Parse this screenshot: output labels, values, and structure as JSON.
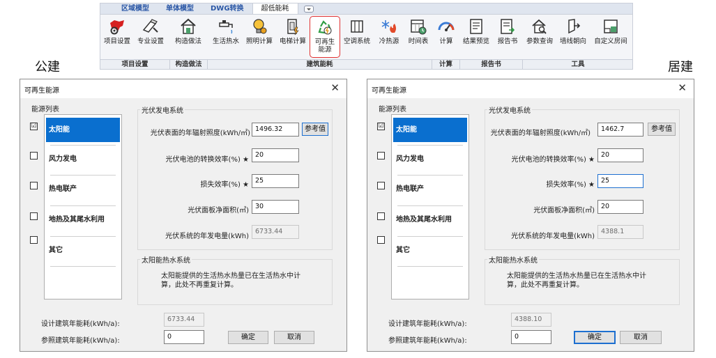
{
  "ribbon": {
    "tabs": [
      "区域模型",
      "单体模型",
      "DWG转换",
      "超低能耗"
    ],
    "buttons": [
      {
        "label": "项目设置",
        "icon": "project-settings-icon"
      },
      {
        "label": "专业设置",
        "icon": "professional-settings-icon"
      },
      {
        "label": "构造做法",
        "icon": "construction-icon"
      },
      {
        "label": "生活热水",
        "icon": "hot-water-faucet-icon"
      },
      {
        "label": "照明计算",
        "icon": "lightbulb-icon"
      },
      {
        "label": "电梯计算",
        "icon": "elevator-icon"
      },
      {
        "label": "可再生\n能源",
        "icon": "renewable-energy-icon"
      },
      {
        "label": "空调系统",
        "icon": "air-conditioner-icon"
      },
      {
        "label": "冷热源",
        "icon": "cold-heat-source-icon"
      },
      {
        "label": "时间表",
        "icon": "schedule-icon"
      },
      {
        "label": "计算",
        "icon": "gauge-icon"
      },
      {
        "label": "结果预览",
        "icon": "result-preview-icon"
      },
      {
        "label": "报告书",
        "icon": "report-icon"
      },
      {
        "label": "参数查询",
        "icon": "parameter-query-icon"
      },
      {
        "label": "墙线朝向",
        "icon": "wall-orientation-icon"
      },
      {
        "label": "自定义房间",
        "icon": "custom-room-icon"
      }
    ],
    "groups": [
      "项目设置",
      "构造做法",
      "建筑能耗",
      "计算",
      "报告书",
      "工具"
    ]
  },
  "labels": {
    "public": "公建",
    "residential": "居建"
  },
  "dialog_common": {
    "title": "可再生能源",
    "energy_list_title": "能源列表",
    "energy_items": [
      "太阳能",
      "风力发电",
      "热电联产",
      "地热及其尾水利用",
      "其它"
    ],
    "pv_title": "光伏发电系统",
    "irradiance_label": "光伏表面的年辐射照度(kWh/㎡)",
    "ref_button": "参考值",
    "efficiency_label": "光伏电池的转换效率(%) ★",
    "loss_label": "损失效率(%) ★",
    "area_label": "光伏面板净面积(㎡)",
    "generation_label": "光伏系统的年发电量(kWh)",
    "hot_water_title": "太阳能热水系统",
    "hot_water_note": "太阳能提供的生活热水热量已在生活热水中计算，此处不再重复计算。",
    "design_label": "设计建筑年能耗(kWh/a):",
    "reference_label": "参照建筑年能耗(kWh/a):",
    "ok_button": "确定",
    "cancel_button": "取消"
  },
  "public_dialog": {
    "solar_checked": "☑",
    "irradiance": "1496.32",
    "efficiency": "20",
    "loss": "25",
    "area": "30",
    "generation": "6733.44",
    "design_energy": "6733.44",
    "reference_energy": "0"
  },
  "residential_dialog": {
    "solar_checked": "☑",
    "irradiance": "1462.7",
    "efficiency": "20",
    "loss": "25",
    "area": "20",
    "generation": "4388.1",
    "design_energy": "4388.10",
    "reference_energy": "0"
  },
  "colors": {
    "accent": "#0a6fcf",
    "highlight": "#e03030"
  }
}
